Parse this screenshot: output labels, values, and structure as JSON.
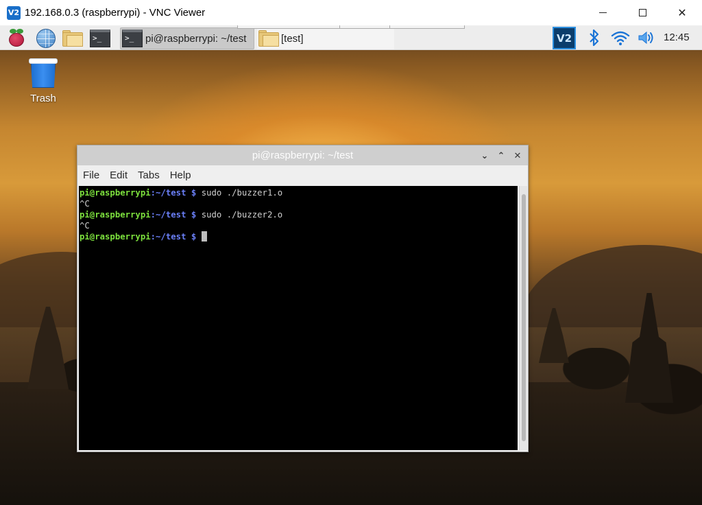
{
  "vnc": {
    "logo_text": "V2",
    "title": "192.168.0.3 (raspberrypi) - VNC Viewer",
    "minimize_glyph": "",
    "close_glyph": "✕"
  },
  "panel": {
    "launchers": [
      {
        "name": "raspberry-menu",
        "icon": "raspberry-icon"
      },
      {
        "name": "web-browser",
        "icon": "globe-icon"
      },
      {
        "name": "file-manager",
        "icon": "folder-icon"
      },
      {
        "name": "terminal",
        "icon": "terminal-icon"
      }
    ],
    "terminal_icon_text": ">_",
    "tasks": [
      {
        "label": "pi@raspberrypi: ~/test",
        "icon": "terminal-icon",
        "active": true
      },
      {
        "label": "[test]",
        "icon": "folder-icon",
        "active": false
      }
    ],
    "tray": {
      "vnc_text": "V2",
      "icons": [
        "bluetooth-icon",
        "wifi-icon",
        "volume-icon"
      ]
    },
    "clock": "12:45"
  },
  "desktop": {
    "trash_label": "Trash"
  },
  "terminal": {
    "title": "pi@raspberrypi: ~/test",
    "menu": [
      "File",
      "Edit",
      "Tabs",
      "Help"
    ],
    "lines": [
      {
        "user": "pi@raspberrypi",
        "path": ":~/test $",
        "cmd": " sudo ./buzzer1.o"
      },
      {
        "text": "^C"
      },
      {
        "user": "pi@raspberrypi",
        "path": ":~/test $",
        "cmd": " sudo ./buzzer2.o"
      },
      {
        "text": "^C"
      },
      {
        "user": "pi@raspberrypi",
        "path": ":~/test $",
        "cmd": " "
      }
    ],
    "controls": {
      "min": "⌄",
      "max": "⌃",
      "close": "✕"
    }
  },
  "colors": {
    "prompt_user": "#7ce03d",
    "prompt_path": "#6a7ff7",
    "terminal_bg": "#000000",
    "titlebar_bg": "#cfcfcf"
  }
}
